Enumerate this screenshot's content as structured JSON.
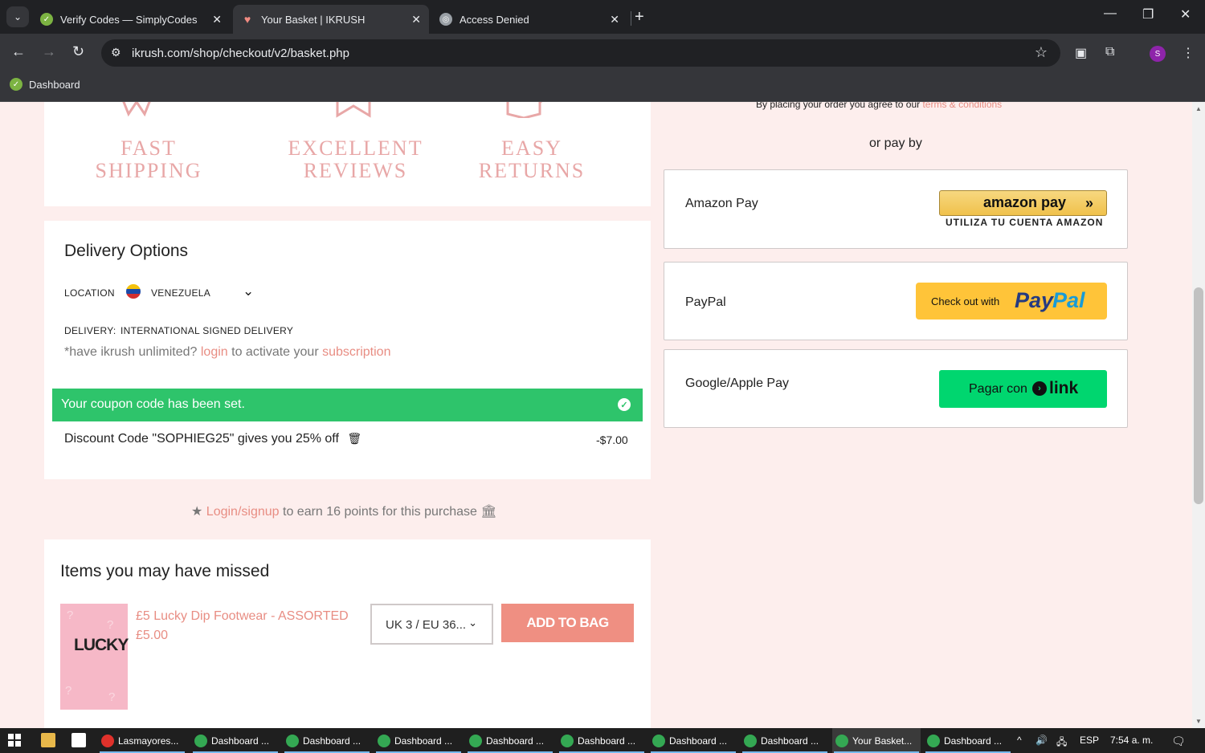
{
  "browser": {
    "tabs": [
      {
        "title": "Verify Codes — SimplyCodes",
        "active": false
      },
      {
        "title": "Your Basket | IKRUSH",
        "active": true
      },
      {
        "title": "Access Denied",
        "active": false
      }
    ],
    "url": "ikrush.com/shop/checkout/v2/basket.php",
    "profile_initial": "S",
    "bookmark": "Dashboard"
  },
  "features": [
    {
      "line1": "FAST",
      "line2": "SHIPPING"
    },
    {
      "line1": "EXCELLENT",
      "line2": "REVIEWS"
    },
    {
      "line1": "EASY",
      "line2": "RETURNS"
    }
  ],
  "delivery": {
    "heading": "Delivery Options",
    "location_label": "LOCATION",
    "location_value": "VENEZUELA",
    "delivery_label": "DELIVERY:",
    "delivery_value": "INTERNATIONAL SIGNED DELIVERY",
    "unlimited_pre": "*have ikrush unlimited?",
    "unlimited_login": "login",
    "unlimited_mid": "to activate your",
    "unlimited_link": "subscription"
  },
  "coupon": {
    "message": "Your coupon code has been set.",
    "discount_text": "Discount Code \"SOPHIEG25\" gives you 25% off",
    "discount_amount": "-$7.00"
  },
  "points": {
    "link": "Login/signup",
    "text": "to earn 16 points for this purchase"
  },
  "missed": {
    "heading": "Items you may have missed",
    "product_name": "£5 Lucky Dip Footwear - ASSORTED",
    "product_price": "£5.00",
    "image_text": "LUCKY",
    "size_value": "UK 3 / EU 36...",
    "add_button": "ADD TO BAG"
  },
  "payment": {
    "terms_pre": "By placing your order you agree to our",
    "terms_link": "terms & conditions",
    "or_pay_by": "or pay by",
    "amazon_label": "Amazon Pay",
    "amazon_btn": "amazon pay",
    "amazon_sub": "UTILIZA TU CUENTA AMAZON",
    "paypal_label": "PayPal",
    "paypal_pre": "Check out with",
    "paypal_pay": "Pay",
    "paypal_pal": "Pal",
    "google_label": "Google/Apple Pay",
    "link_pre": "Pagar con",
    "link_word": "link"
  },
  "taskbar": {
    "items": [
      {
        "label": "Lasmayores...",
        "color": "#e0312b"
      },
      {
        "label": "Dashboard ...",
        "color": "#34a853"
      },
      {
        "label": "Dashboard ...",
        "color": "#34a853"
      },
      {
        "label": "Dashboard ...",
        "color": "#34a853"
      },
      {
        "label": "Dashboard ...",
        "color": "#34a853"
      },
      {
        "label": "Dashboard ...",
        "color": "#34a853"
      },
      {
        "label": "Dashboard ...",
        "color": "#34a853"
      },
      {
        "label": "Dashboard ...",
        "color": "#34a853"
      },
      {
        "label": "Your Basket...",
        "color": "#34a853"
      },
      {
        "label": "Dashboard ...",
        "color": "#34a853"
      }
    ],
    "lang": "ESP",
    "time": "7:54 a. m."
  }
}
